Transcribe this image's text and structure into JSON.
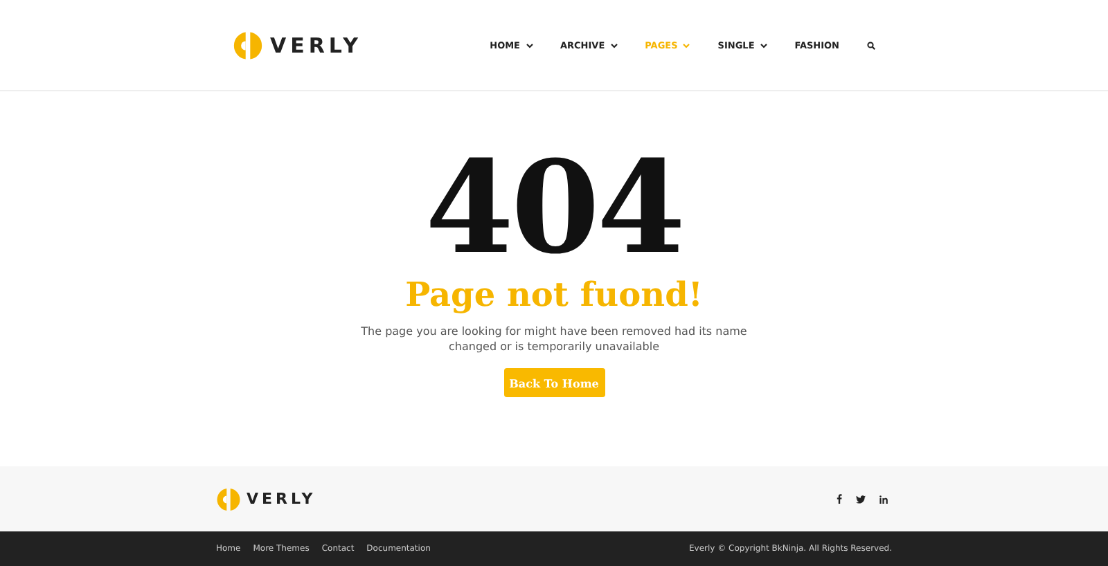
{
  "header": {
    "logo": "VERLY",
    "nav": [
      {
        "label": "HOME",
        "has_dropdown": true,
        "selected": false
      },
      {
        "label": "ARCHIVE",
        "has_dropdown": true,
        "selected": false
      },
      {
        "label": "PAGES",
        "has_dropdown": true,
        "selected": true
      },
      {
        "label": "SINGLE",
        "has_dropdown": true,
        "selected": false
      },
      {
        "label": "FASHION",
        "has_dropdown": false,
        "selected": false
      }
    ]
  },
  "error": {
    "code": "404",
    "title": "Page not fuond!",
    "message": "The page you are looking for might have been removed had its name changed or is temporarily unavailable",
    "button": "Back To Home"
  },
  "footer": {
    "logo": "VERLY",
    "social": [
      {
        "kind": "facebook"
      },
      {
        "kind": "twitter"
      },
      {
        "kind": "linkedin"
      }
    ],
    "links": [
      "Home",
      "More Themes",
      "Contact",
      "Documentation"
    ],
    "copyright": "Everly © Copyright BkNinja. All Rights Reserved."
  }
}
